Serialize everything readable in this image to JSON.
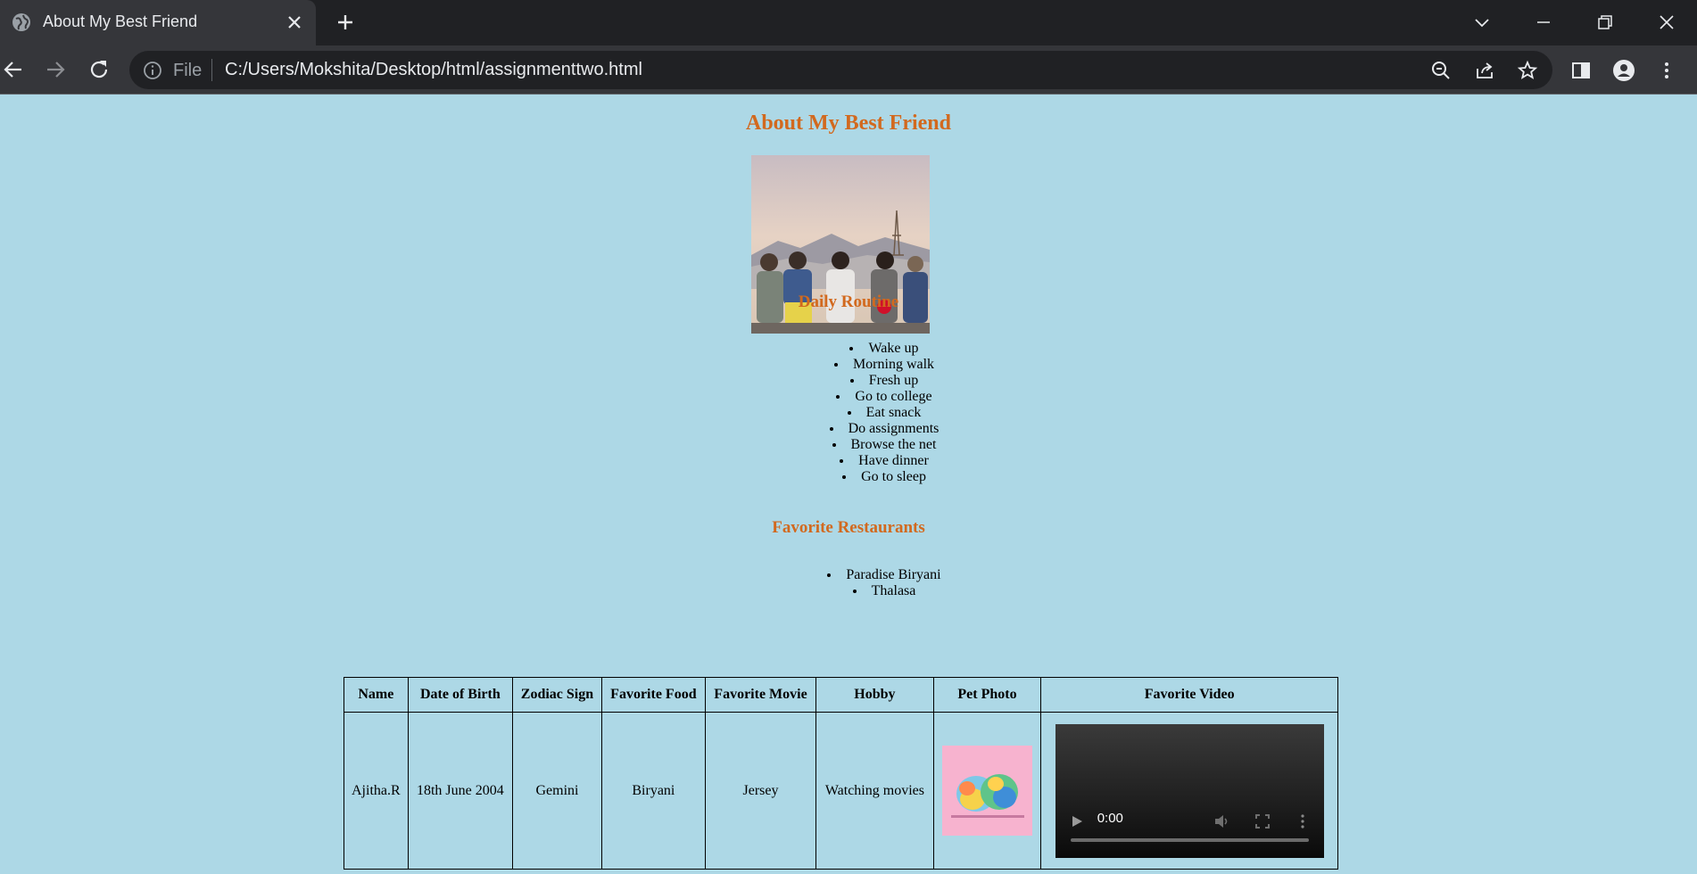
{
  "browser": {
    "tab_title": "About My Best Friend",
    "address_scheme": "File",
    "url": "C:/Users/Mokshita/Desktop/html/assignmenttwo.html"
  },
  "page": {
    "title": "About My Best Friend",
    "photo_alt": "Friends",
    "routine_heading": "Daily Routine",
    "routine": [
      "Wake up",
      "Morning walk",
      "Fresh up",
      "Go to college",
      "Eat snack",
      "Do assignments",
      "Browse the net",
      "Have dinner",
      "Go to sleep"
    ],
    "restaurants_heading": "Favorite Restaurants",
    "restaurants": [
      "Paradise Biryani",
      "Thalasa"
    ],
    "table": {
      "headers": [
        "Name",
        "Date of Birth",
        "Zodiac Sign",
        "Favorite Food",
        "Favorite Movie",
        "Hobby",
        "Pet Photo",
        "Favorite Video"
      ],
      "row": {
        "name": "Ajitha.R",
        "dob": "18th June 2004",
        "zodiac": "Gemini",
        "food": "Biryani",
        "movie": "Jersey",
        "hobby": "Watching movies"
      }
    },
    "video_time": "0:00"
  },
  "colors": {
    "background": "#add8e6",
    "heading": "#d2691e"
  }
}
